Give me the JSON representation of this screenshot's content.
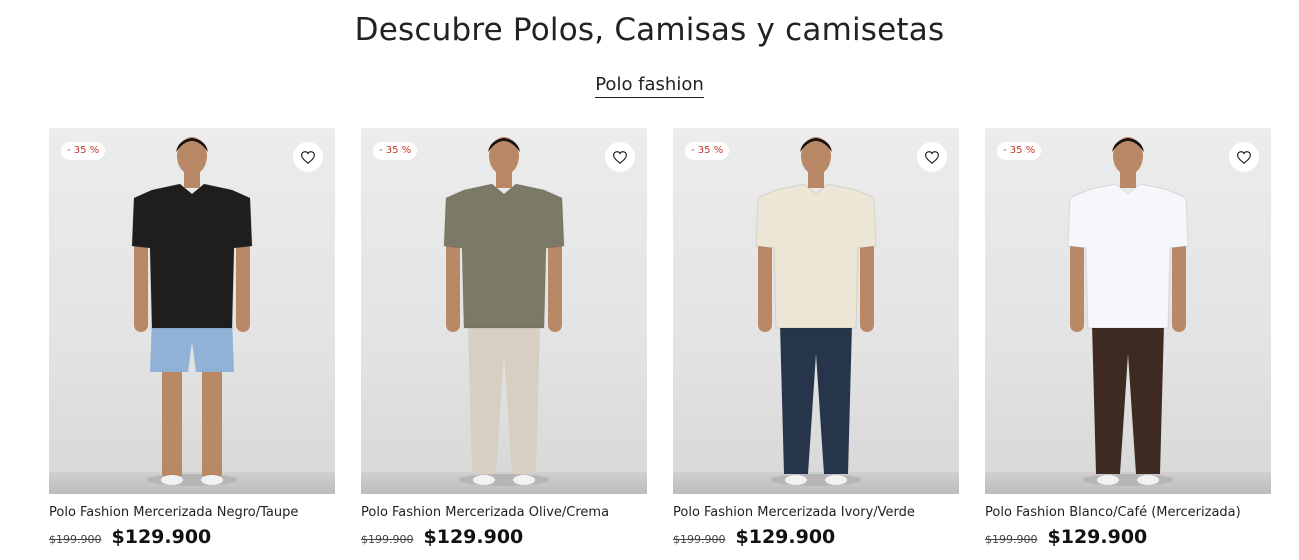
{
  "header": {
    "title": "Descubre Polos, Camisas y camisetas",
    "collection_link": "Polo fashion"
  },
  "products": [
    {
      "name": "Polo Fashion Mercerizada Negro/Taupe",
      "badge": "- 35 %",
      "old_price": "$199.900",
      "price": "$129.900",
      "shirt_color": "#1e1e1e",
      "pants_color": "#8fb2d6",
      "pants_style": "shorts"
    },
    {
      "name": "Polo Fashion Mercerizada Olive/Crema",
      "badge": "- 35 %",
      "old_price": "$199.900",
      "price": "$129.900",
      "shirt_color": "#7a7a66",
      "pants_color": "#d6cfc2",
      "pants_style": "long"
    },
    {
      "name": "Polo Fashion Mercerizada Ivory/Verde",
      "badge": "- 35 %",
      "old_price": "$199.900",
      "price": "$129.900",
      "shirt_color": "#ece6d6",
      "pants_color": "#27354a",
      "pants_style": "long"
    },
    {
      "name": "Polo Fashion Blanco/Café (Mercerizada)",
      "badge": "- 35 %",
      "old_price": "$199.900",
      "price": "$129.900",
      "shirt_color": "#f6f7fb",
      "pants_color": "#3d2a20",
      "pants_style": "long"
    }
  ],
  "icons": {
    "wishlist": "heart-icon"
  },
  "colors": {
    "badge_text": "#c0392b",
    "price_text": "#111111"
  }
}
